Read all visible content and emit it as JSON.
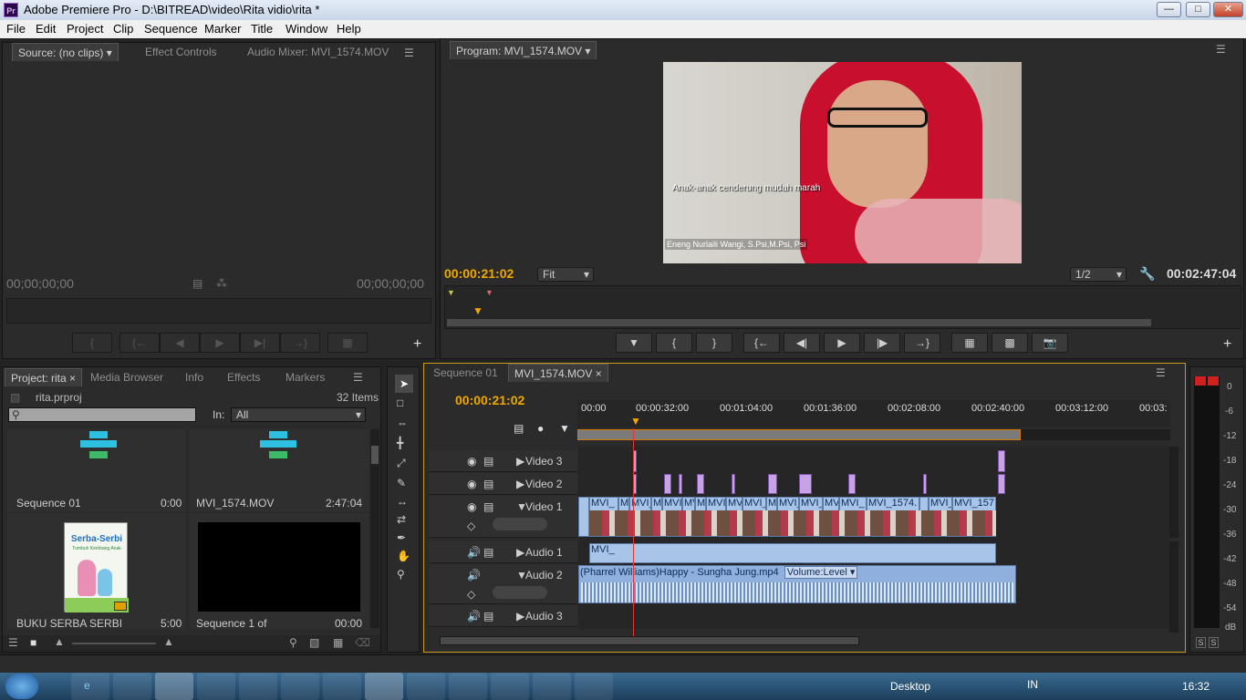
{
  "window": {
    "title": "Adobe Premiere Pro - D:\\BITREAD\\video\\Rita vidio\\rita *",
    "logo": "Pr"
  },
  "menu": [
    "File",
    "Edit",
    "Project",
    "Clip",
    "Sequence",
    "Marker",
    "Title",
    "Window",
    "Help"
  ],
  "source": {
    "tabs": [
      "Source: (no clips)",
      "Effect Controls",
      "Audio Mixer: MVI_1574.MOV"
    ],
    "tc_in": "00;00;00;00",
    "tc_out": "00;00;00;00"
  },
  "program": {
    "tab": "Program: MVI_1574.MOV",
    "tc_current": "00:00:21:02",
    "fit": "Fit",
    "resolution": "1/2",
    "tc_duration": "00:02:47:04",
    "subtitle": "Anak-anak cenderung mudah marah",
    "caption": "Eneng Nurlaili Wangi, S.Psi,M.Psi, Psi"
  },
  "project": {
    "tabs": [
      "Project: rita",
      "Media Browser",
      "Info",
      "Effects",
      "Markers"
    ],
    "file": "rita.prproj",
    "count": "32 Items",
    "in_label": "In:",
    "in_value": "All",
    "items": [
      {
        "name": "Sequence 01",
        "dur": "0:00"
      },
      {
        "name": "MVI_1574.MOV",
        "dur": "2:47:04"
      },
      {
        "name": "BUKU SERBA SERBI",
        "dur": "5:00"
      },
      {
        "name": "Sequence 1 of",
        "dur": "00:00"
      }
    ],
    "book_title": "Serba-Serbi",
    "book_sub": "Tumbuh Kembang Anak"
  },
  "timeline": {
    "tabs": [
      "Sequence 01",
      "MVI_1574.MOV"
    ],
    "tc": "00:00:21:02",
    "ruler": [
      "00:00",
      "00:00:32:00",
      "00:01:04:00",
      "00:01:36:00",
      "00:02:08:00",
      "00:02:40:00",
      "00:03:12:00",
      "00:03:"
    ],
    "tracks": [
      "Video 3",
      "Video 2",
      "Video 1",
      "Audio 1",
      "Audio 2",
      "Audio 3"
    ],
    "clip_label": "MVI_",
    "clip_label2": "MVI_1574.",
    "clip_label3": "MVI_157",
    "audio_clip": "(Pharrel Williams)Happy - Sungha Jung.mp4",
    "volume": "Volume:Level"
  },
  "meter": {
    "scale": [
      "0",
      "-6",
      "-12",
      "-18",
      "-24",
      "-30",
      "-36",
      "-42",
      "-48",
      "-54",
      "dB"
    ],
    "solo": "S"
  },
  "taskbar": {
    "desktop": "Desktop",
    "lang": "IN",
    "clock": "16:32"
  }
}
